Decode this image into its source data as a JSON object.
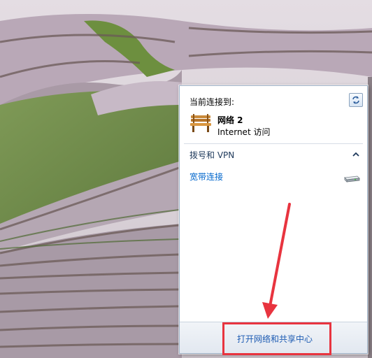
{
  "flyout": {
    "connected_label": "当前连接到:",
    "network": {
      "name": "网络  2",
      "access": "Internet 访问",
      "icon": "bench-network-icon"
    },
    "dialup_section": {
      "title": "拨号和 VPN",
      "connection": "宽带连接",
      "icon": "modem-icon"
    },
    "footer_link": "打开网络和共享中心"
  },
  "colors": {
    "link": "#0066cc",
    "annotation": "#e8343f",
    "section_heading": "#1e395b"
  }
}
